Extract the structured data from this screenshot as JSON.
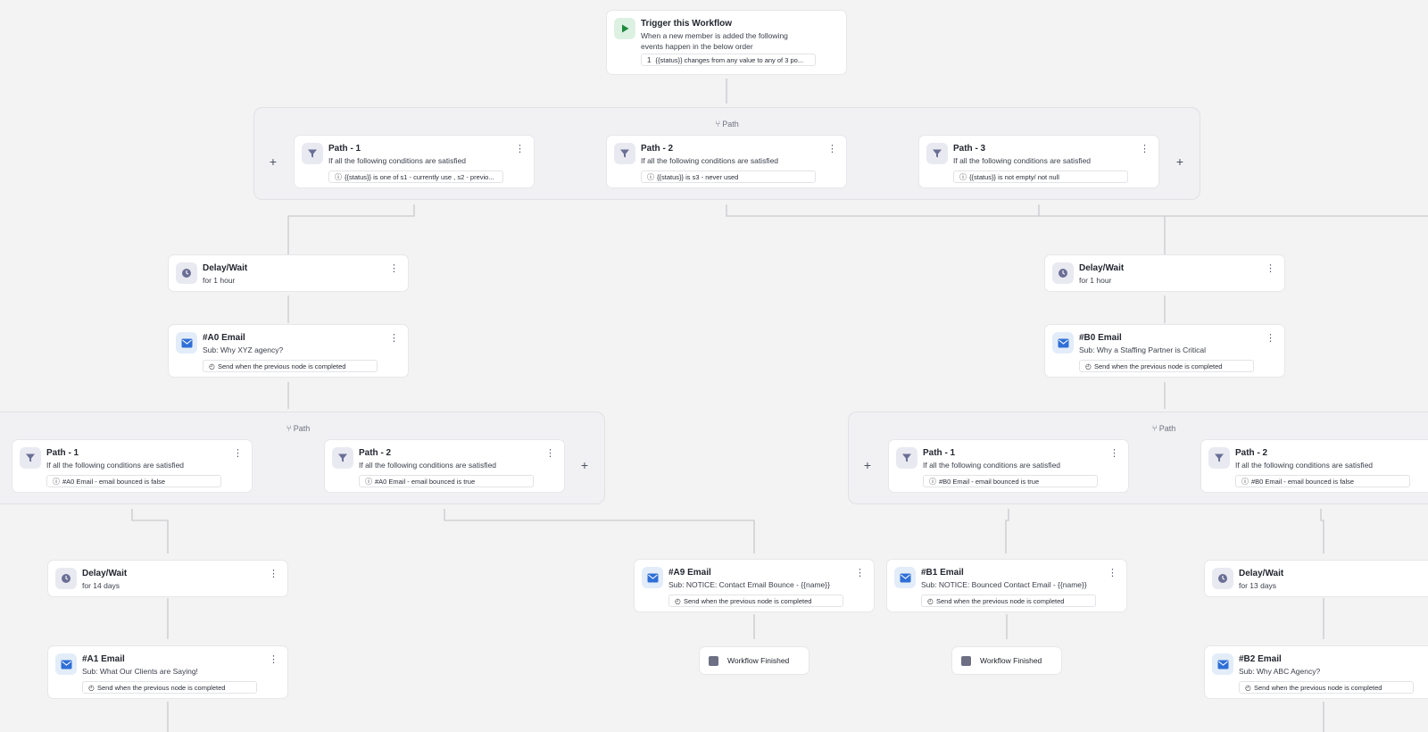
{
  "trigger": {
    "title": "Trigger this Workflow",
    "desc": "When a new member is added the following events happen in the below order",
    "condition_index": "1",
    "condition": "{{status}} changes from any value to any of 3 po..."
  },
  "group_label": "Path",
  "top_paths": [
    {
      "title": "Path - 1",
      "desc": "If all the following conditions are satisfied",
      "condition": "{{status}} is one of s1 - currently use , s2 - previo..."
    },
    {
      "title": "Path - 2",
      "desc": "If all the following conditions are satisfied",
      "condition": "{{status}} is s3 - never used"
    },
    {
      "title": "Path - 3",
      "desc": "If all the following conditions are satisfied",
      "condition": "{{status}} is not empty/ not null"
    }
  ],
  "delays": [
    {
      "title": "Delay/Wait",
      "desc": "for 1 hour"
    },
    {
      "title": "Delay/Wait",
      "desc": "for 1 hour"
    },
    {
      "title": "Delay/Wait",
      "desc": "for 14 days"
    },
    {
      "title": "Delay/Wait",
      "desc": "for 13 days"
    }
  ],
  "emails": [
    {
      "title": "#A0 Email",
      "desc": "Sub: Why XYZ agency?",
      "chip": "Send when the previous node is completed"
    },
    {
      "title": "#B0 Email",
      "desc": "Sub: Why a Staffing Partner is Critical",
      "chip": "Send when the previous node is completed"
    },
    {
      "title": "#A9 Email",
      "desc": "Sub: NOTICE: Contact Email Bounce - {{name}}",
      "chip": "Send when the previous node is completed"
    },
    {
      "title": "#B1 Email",
      "desc": "Sub: NOTICE: Bounced Contact Email - {{name}}",
      "chip": "Send when the previous node is completed"
    },
    {
      "title": "#A1 Email",
      "desc": "Sub: What Our Clients are Saying!",
      "chip": "Send when the previous node is completed"
    },
    {
      "title": "#B2 Email",
      "desc": "Sub: Why ABC Agency?",
      "chip": "Send when the previous node is completed"
    }
  ],
  "a_paths": [
    {
      "title": "Path - 1",
      "desc": "If all the following conditions are satisfied",
      "condition": "#A0 Email - email bounced is false"
    },
    {
      "title": "Path - 2",
      "desc": "If all the following conditions are satisfied",
      "condition": "#A0 Email - email bounced is true"
    }
  ],
  "b_paths": [
    {
      "title": "Path - 1",
      "desc": "If all the following conditions are satisfied",
      "condition": "#B0 Email - email bounced is true"
    },
    {
      "title": "Path - 2",
      "desc": "If all the following conditions are satisfied",
      "condition": "#B0 Email - email bounced is false"
    }
  ],
  "finished_label": "Workflow Finished",
  "icons": {
    "play": "play-icon",
    "filter": "filter-icon",
    "clock": "clock-icon",
    "mail": "mail-icon",
    "menu": "more-vertical-icon",
    "add": "plus-icon",
    "branch": "branch-icon",
    "stop": "stop-icon",
    "timer": "timer-icon",
    "info": "info-icon"
  },
  "colors": {
    "canvas": "#f3f3f4",
    "play_accent": "#1f8a3a",
    "mail_accent": "#2f6fd6",
    "filter_accent": "#6b6f95",
    "connector": "#c9cace"
  }
}
